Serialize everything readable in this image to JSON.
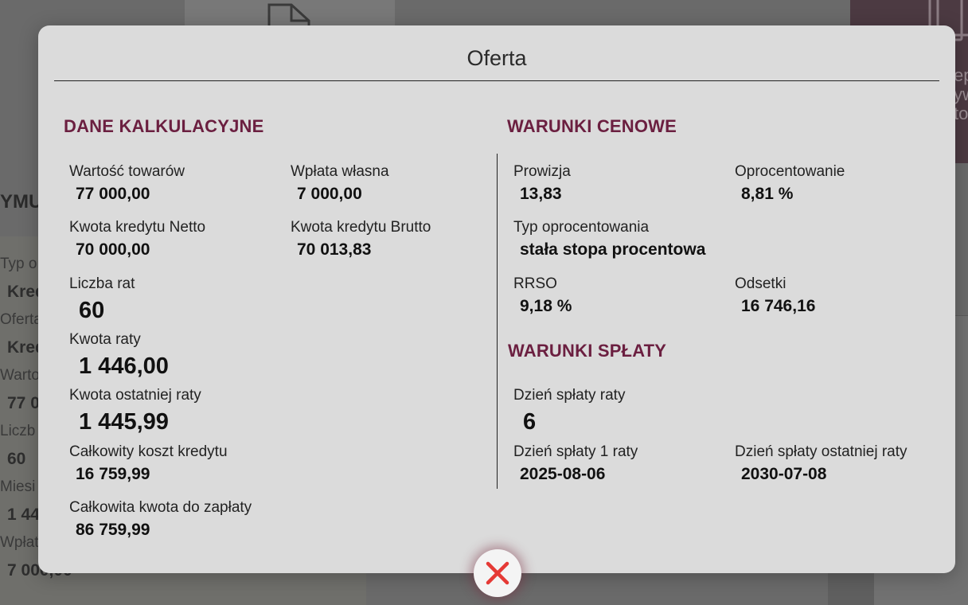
{
  "background": {
    "heading_fragment": "YMU",
    "dark_card_lines": [
      "ep",
      "yw",
      "to"
    ],
    "fields": [
      {
        "label": "Typ o",
        "value": "Kred"
      },
      {
        "label": "Oferta",
        "value": "Kred"
      },
      {
        "label": "Warto",
        "value": "77 0"
      },
      {
        "label": "Liczb",
        "value": "60"
      },
      {
        "label": "Miesi",
        "value": "1 44"
      },
      {
        "label": "Wpłat",
        "value": "7 000,00"
      }
    ]
  },
  "modal": {
    "title": "Oferta",
    "close_icon": "close-x-icon",
    "accent_color": "#6b1f40",
    "close_color": "#e53935",
    "sections": {
      "dane": {
        "title": "DANE KALKULACYJNE",
        "wartosc_towarow": {
          "label": "Wartość towarów",
          "value": "77 000,00"
        },
        "wplata_wlasna": {
          "label": "Wpłata własna",
          "value": "7 000,00"
        },
        "kwota_netto": {
          "label": "Kwota kredytu Netto",
          "value": "70 000,00"
        },
        "kwota_brutto": {
          "label": "Kwota kredytu Brutto",
          "value": "70 013,83"
        },
        "liczba_rat": {
          "label": "Liczba rat",
          "value": "60"
        },
        "kwota_raty": {
          "label": "Kwota raty",
          "value": "1 446,00"
        },
        "kwota_ostatniej": {
          "label": "Kwota ostatniej raty",
          "value": "1 445,99"
        },
        "calkowity_koszt": {
          "label": "Całkowity koszt kredytu",
          "value": "16 759,99"
        },
        "calkowita_kwota": {
          "label": "Całkowita kwota do zapłaty",
          "value": "86 759,99"
        }
      },
      "cenowe": {
        "title": "WARUNKI CENOWE",
        "prowizja": {
          "label": "Prowizja",
          "value": "13,83"
        },
        "oprocentowanie": {
          "label": "Oprocentowanie",
          "value": "8,81 %"
        },
        "typ_oprocentowania": {
          "label": "Typ oprocentowania",
          "value": "stała stopa procentowa"
        },
        "rrso": {
          "label": "RRSO",
          "value": "9,18 %"
        },
        "odsetki": {
          "label": "Odsetki",
          "value": "16 746,16"
        }
      },
      "splaty": {
        "title": "WARUNKI SPŁATY",
        "dzien_splaty": {
          "label": "Dzień spłaty raty",
          "value": "6"
        },
        "dzien_1_raty": {
          "label": "Dzień spłaty 1 raty",
          "value": "2025-08-06"
        },
        "dzien_ostatniej": {
          "label": "Dzień spłaty ostatniej raty",
          "value": "2030-07-08"
        }
      }
    }
  }
}
